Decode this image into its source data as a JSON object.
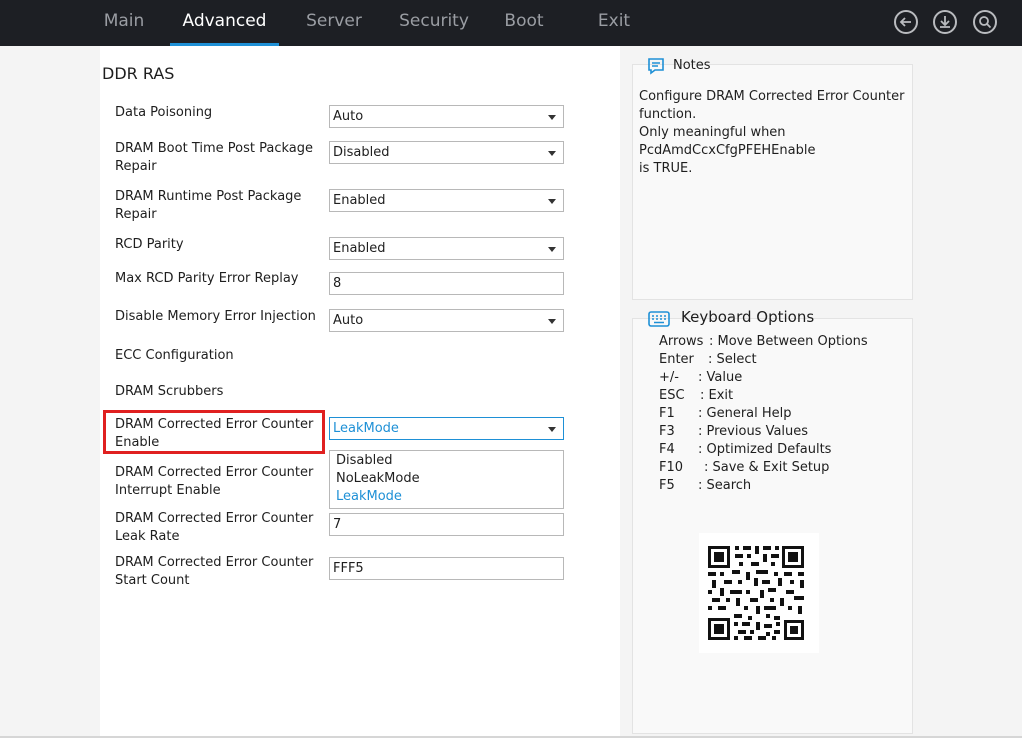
{
  "tabs": [
    {
      "label": "Main"
    },
    {
      "label": "Advanced"
    },
    {
      "label": "Server"
    },
    {
      "label": "Security"
    },
    {
      "label": "Boot"
    },
    {
      "label": "Exit"
    }
  ],
  "icons": {
    "back": "back-arrow-icon",
    "save": "download-icon",
    "search": "search-icon",
    "notes": "notes-icon",
    "keyboard": "keyboard-icon"
  },
  "colors": {
    "accent": "#1e90d6",
    "highlight": "#e02020",
    "topbar": "#1d1f24"
  },
  "section_title": "DDR RAS",
  "settings": [
    {
      "label_lines": [
        "Data Poisoning"
      ],
      "value": "Auto",
      "type": "dropdown"
    },
    {
      "label_lines": [
        "DRAM Boot Time Post Package",
        "Repair"
      ],
      "value": "Disabled",
      "type": "dropdown"
    },
    {
      "label_lines": [
        "DRAM Runtime Post Package",
        "Repair"
      ],
      "value": "Enabled",
      "type": "dropdown"
    },
    {
      "label_lines": [
        "RCD Parity"
      ],
      "value": "Enabled",
      "type": "dropdown"
    },
    {
      "label_lines": [
        "Max RCD Parity Error Replay"
      ],
      "value": "8",
      "type": "text"
    },
    {
      "label_lines": [
        "Disable Memory Error Injection"
      ],
      "value": "Auto",
      "type": "dropdown"
    },
    {
      "label_lines": [
        "ECC Configuration"
      ],
      "type": "submenu"
    },
    {
      "label_lines": [
        "DRAM Scrubbers"
      ],
      "type": "submenu"
    },
    {
      "label_lines": [
        "DRAM Corrected Error Counter",
        "Enable"
      ],
      "value": "LeakMode",
      "type": "dropdown",
      "active": true
    },
    {
      "label_lines": [
        "DRAM Corrected Error Counter",
        "Interrupt Enable"
      ],
      "type": "dropdown"
    },
    {
      "label_lines": [
        "DRAM Corrected Error Counter",
        "Leak Rate"
      ],
      "value": "7",
      "type": "text"
    },
    {
      "label_lines": [
        "DRAM Corrected Error Counter",
        "Start Count"
      ],
      "value": "FFF5",
      "type": "text"
    }
  ],
  "dropdown_options": [
    "Disabled",
    "NoLeakMode",
    "LeakMode"
  ],
  "dropdown_selected": "LeakMode",
  "notes": {
    "title": "Notes",
    "lines": [
      "Configure DRAM Corrected Error Counter",
      "function.",
      "Only meaningful when",
      "PcdAmdCcxCfgPFEHEnable",
      "is TRUE."
    ]
  },
  "keyboard": {
    "title": "Keyboard Options",
    "rows": [
      {
        "key": "Arrows",
        "desc": ": Move Between Options"
      },
      {
        "key": "Enter",
        "desc": ": Select"
      },
      {
        "key": "+/-",
        "desc": ": Value"
      },
      {
        "key": "ESC",
        "desc": ": Exit"
      },
      {
        "key": "F1",
        "desc": ": General Help"
      },
      {
        "key": "F3",
        "desc": ": Previous Values"
      },
      {
        "key": "F4",
        "desc": ": Optimized Defaults"
      },
      {
        "key": "F10",
        "desc": ": Save & Exit Setup"
      },
      {
        "key": "F5",
        "desc": ": Search"
      }
    ]
  }
}
